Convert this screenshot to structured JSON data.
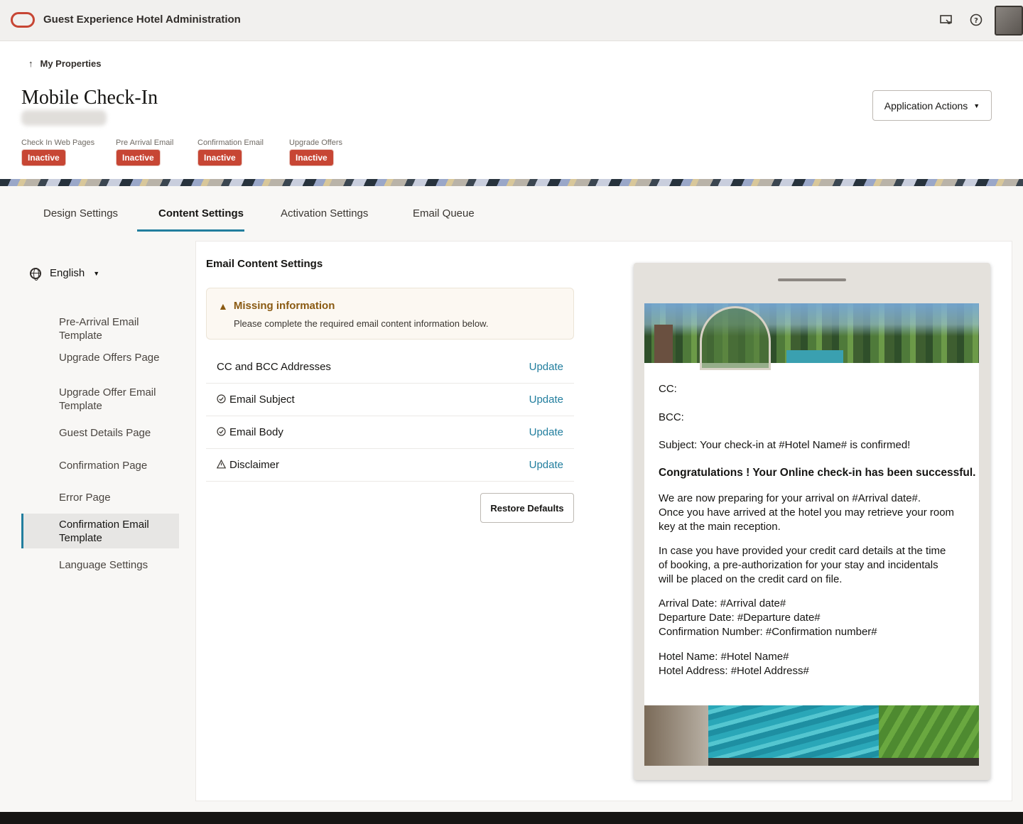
{
  "app": {
    "title": "Guest Experience Hotel Administration"
  },
  "header": {
    "back_link": "My Properties",
    "page_title": "Mobile Check-In",
    "statuses": [
      {
        "label": "Check In Web Pages",
        "status": "Inactive"
      },
      {
        "label": "Pre Arrival Email",
        "status": "Inactive"
      },
      {
        "label": "Confirmation Email",
        "status": "Inactive"
      },
      {
        "label": "Upgrade Offers",
        "status": "Inactive"
      }
    ],
    "actions_button": "Application Actions"
  },
  "tabs": [
    {
      "label": "Design Settings",
      "active": false
    },
    {
      "label": "Content Settings",
      "active": true
    },
    {
      "label": "Activation Settings",
      "active": false
    },
    {
      "label": "Email Queue",
      "active": false
    }
  ],
  "sidebar": {
    "language": "English",
    "items": [
      {
        "label": "Pre-Arrival Email Template",
        "active": false
      },
      {
        "label": "Upgrade Offers Page",
        "active": false
      },
      {
        "label": "Upgrade Offer Email Template",
        "active": false
      },
      {
        "label": "Guest Details Page",
        "active": false
      },
      {
        "label": "Confirmation Page",
        "active": false
      },
      {
        "label": "Error Page",
        "active": false
      },
      {
        "label": "Confirmation Email Template",
        "active": true
      },
      {
        "label": "Language Settings",
        "active": false
      }
    ]
  },
  "content": {
    "section_title": "Email Content Settings",
    "warning": {
      "title": "Missing information",
      "text": "Please complete the required email content information below."
    },
    "rows": [
      {
        "label": "CC and BCC Addresses",
        "icon": "none",
        "action": "Update"
      },
      {
        "label": "Email Subject",
        "icon": "check-circle-icon",
        "action": "Update"
      },
      {
        "label": "Email Body",
        "icon": "check-circle-icon",
        "action": "Update"
      },
      {
        "label": "Disclaimer",
        "icon": "warning-icon",
        "action": "Update"
      }
    ],
    "restore_button": "Restore Defaults"
  },
  "preview": {
    "cc": "CC:",
    "bcc": "BCC:",
    "subject": "Subject: Your check-in at #Hotel Name# is confirmed!",
    "headline": "Congratulations ! Your Online check-in has been successful.",
    "para1_line1": "We are now preparing for your arrival on #Arrival date#.",
    "para1_line2": "Once you have arrived at the hotel you may retrieve your room",
    "para1_line3": "key at the main reception.",
    "para2_line1": "In case you have provided your credit card details at the time",
    "para2_line2": "of booking, a pre-authorization for your stay and incidentals",
    "para2_line3": "will be placed on the credit card on file.",
    "arrival": "Arrival Date: #Arrival date#",
    "departure": "Departure Date: #Departure date#",
    "confirmation": "Confirmation Number: #Confirmation number#",
    "hotel_name": "Hotel Name: #Hotel Name#",
    "hotel_address": "Hotel Address: #Hotel Address#"
  },
  "colors": {
    "brand_red": "#c74634",
    "accent_teal": "#227e9e",
    "warning_brown": "#8a5a12"
  }
}
